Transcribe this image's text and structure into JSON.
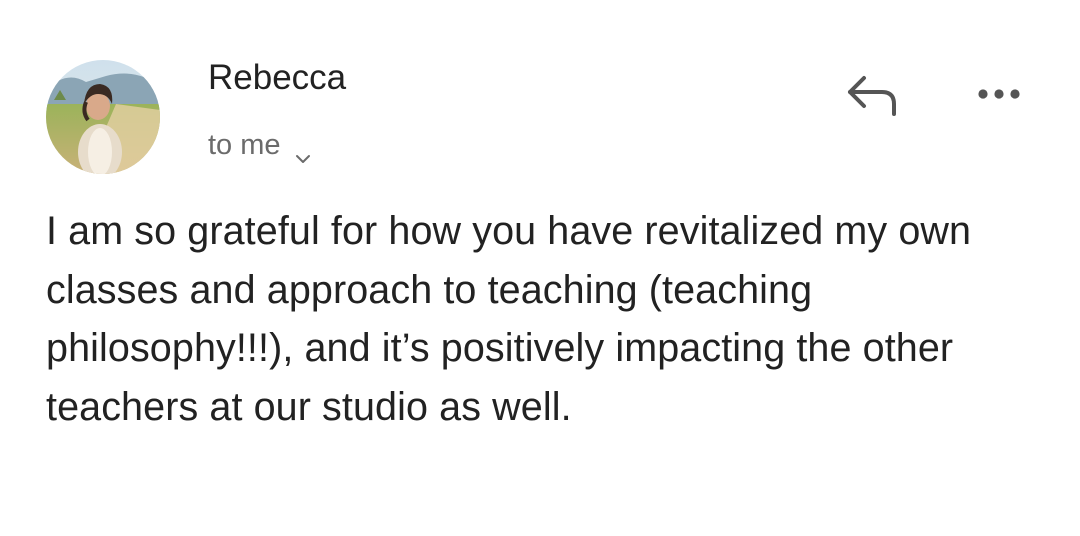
{
  "message": {
    "sender": "Rebecca",
    "recipient": "to me",
    "body": "I am so grateful for how you have revitalized my own classes and approach to teaching (teaching philosophy!!!), and it’s positively impacting the other teachers at our studio as well."
  },
  "icons": {
    "avatar": "avatar-photo",
    "recipient_toggle": "chevron-down-icon",
    "reply": "reply-arrow-icon",
    "more": "more-options-icon"
  }
}
